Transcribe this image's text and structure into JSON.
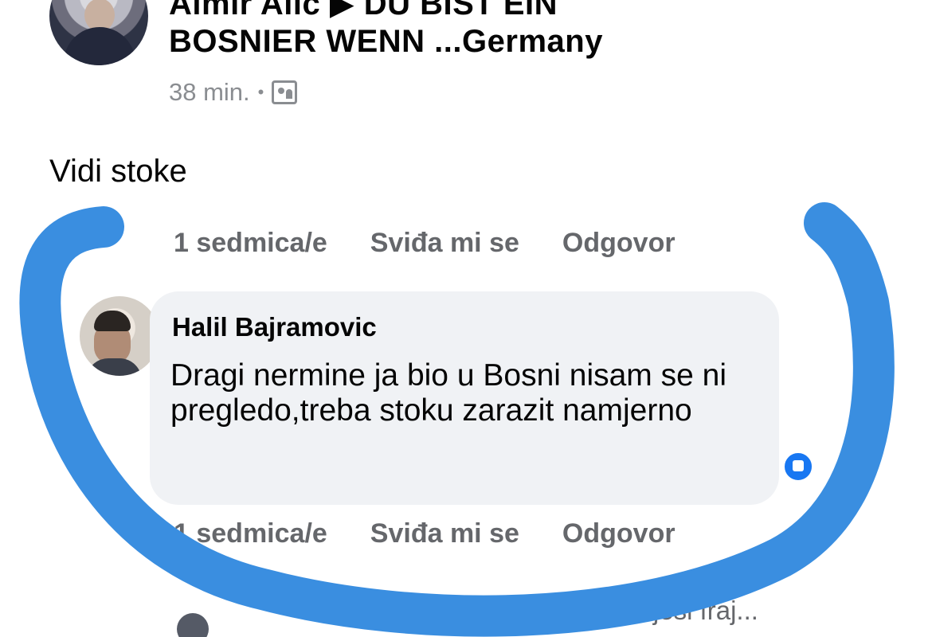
{
  "post": {
    "header_line1": "Almir Alic ▶ DU BIST EIN",
    "header_line2": "BOSNIER WENN ...Germany",
    "time": "38 min.",
    "dot": "•",
    "text": "Vidi stoke"
  },
  "first_comment_actions": {
    "time": "1 sedmica/e",
    "like": "Sviđa mi se",
    "reply": "Odgovor"
  },
  "comment": {
    "author": "Halil Bajramovic",
    "text": "Dragi nermine ja bio u Bosni nisam se ni pregledo,treba stoku zarazit namjerno",
    "reaction_icon": "like-icon",
    "reaction_count": "",
    "actions": {
      "time": "1 sedmica/e",
      "like": "Sviđa mi se",
      "reply": "Odgovor"
    }
  },
  "bottom": {
    "snippet": "...ju a jesi fraj..."
  },
  "colors": {
    "highlight_stroke": "#3a8ee0",
    "bubble_bg": "#f0f2f5",
    "meta_gray": "#65676b"
  }
}
